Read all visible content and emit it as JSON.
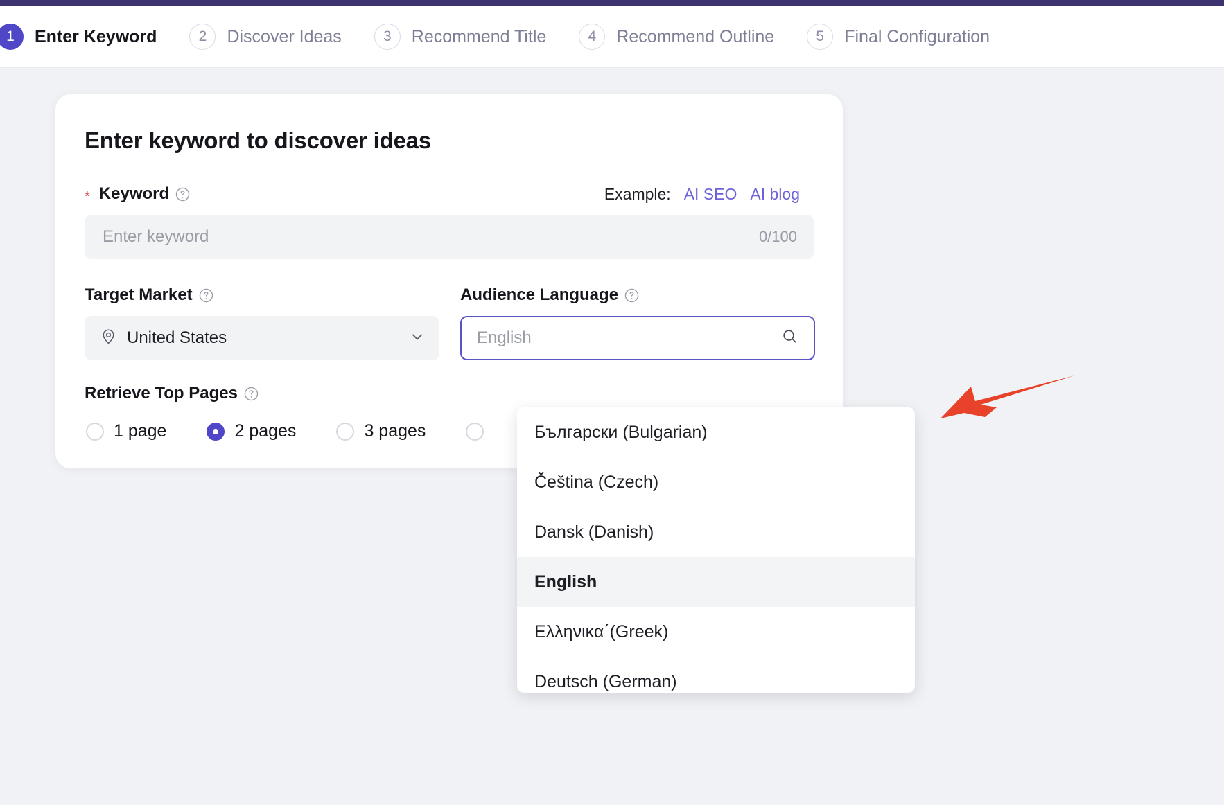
{
  "theme": {
    "accent": "#4f46c8",
    "link": "#6c63d8",
    "top_strip": "#3c3270",
    "required_star": "#e5484d",
    "page_bg": "#f0f2f5",
    "annotation_arrow": "#e8422a"
  },
  "stepper": {
    "steps": [
      {
        "num": "1",
        "label": "Enter Keyword",
        "active": true
      },
      {
        "num": "2",
        "label": "Discover Ideas",
        "active": false
      },
      {
        "num": "3",
        "label": "Recommend Title",
        "active": false
      },
      {
        "num": "4",
        "label": "Recommend Outline",
        "active": false
      },
      {
        "num": "5",
        "label": "Final Configuration",
        "active": false
      }
    ]
  },
  "card": {
    "title": "Enter keyword to discover ideas",
    "keyword": {
      "required_star": "*",
      "label": "Keyword",
      "help_icon": "question-circle-icon",
      "example_text": "Example:",
      "example_links": [
        "AI SEO",
        "AI blog"
      ],
      "placeholder": "Enter keyword",
      "value": "",
      "counter": "0/100"
    },
    "target_market": {
      "label": "Target Market",
      "help_icon": "question-circle-icon",
      "icon": "location-pin-icon",
      "value": "United States",
      "chevron_icon": "chevron-down-icon"
    },
    "audience_language": {
      "label": "Audience Language",
      "help_icon": "question-circle-icon",
      "placeholder": "English",
      "value": "",
      "search_icon": "search-icon",
      "focused": true
    },
    "retrieve_top_pages": {
      "label": "Retrieve Top Pages",
      "help_icon": "question-circle-icon",
      "options": [
        {
          "label": "1 page",
          "checked": false
        },
        {
          "label": "2 pages",
          "checked": true
        },
        {
          "label": "3 pages",
          "checked": false
        },
        {
          "label": "",
          "checked": false
        }
      ]
    }
  },
  "language_dropdown": {
    "items": [
      {
        "label": "Български (Bulgarian)",
        "selected": false
      },
      {
        "label": "Čeština (Czech)",
        "selected": false
      },
      {
        "label": "Dansk (Danish)",
        "selected": false
      },
      {
        "label": "English",
        "selected": true
      },
      {
        "label": "Ελληνικα΄(Greek)",
        "selected": false
      },
      {
        "label": "Deutsch (German)",
        "selected": false
      }
    ]
  },
  "annotation": {
    "arrow_icon": "red-arrow-pointing-left"
  }
}
